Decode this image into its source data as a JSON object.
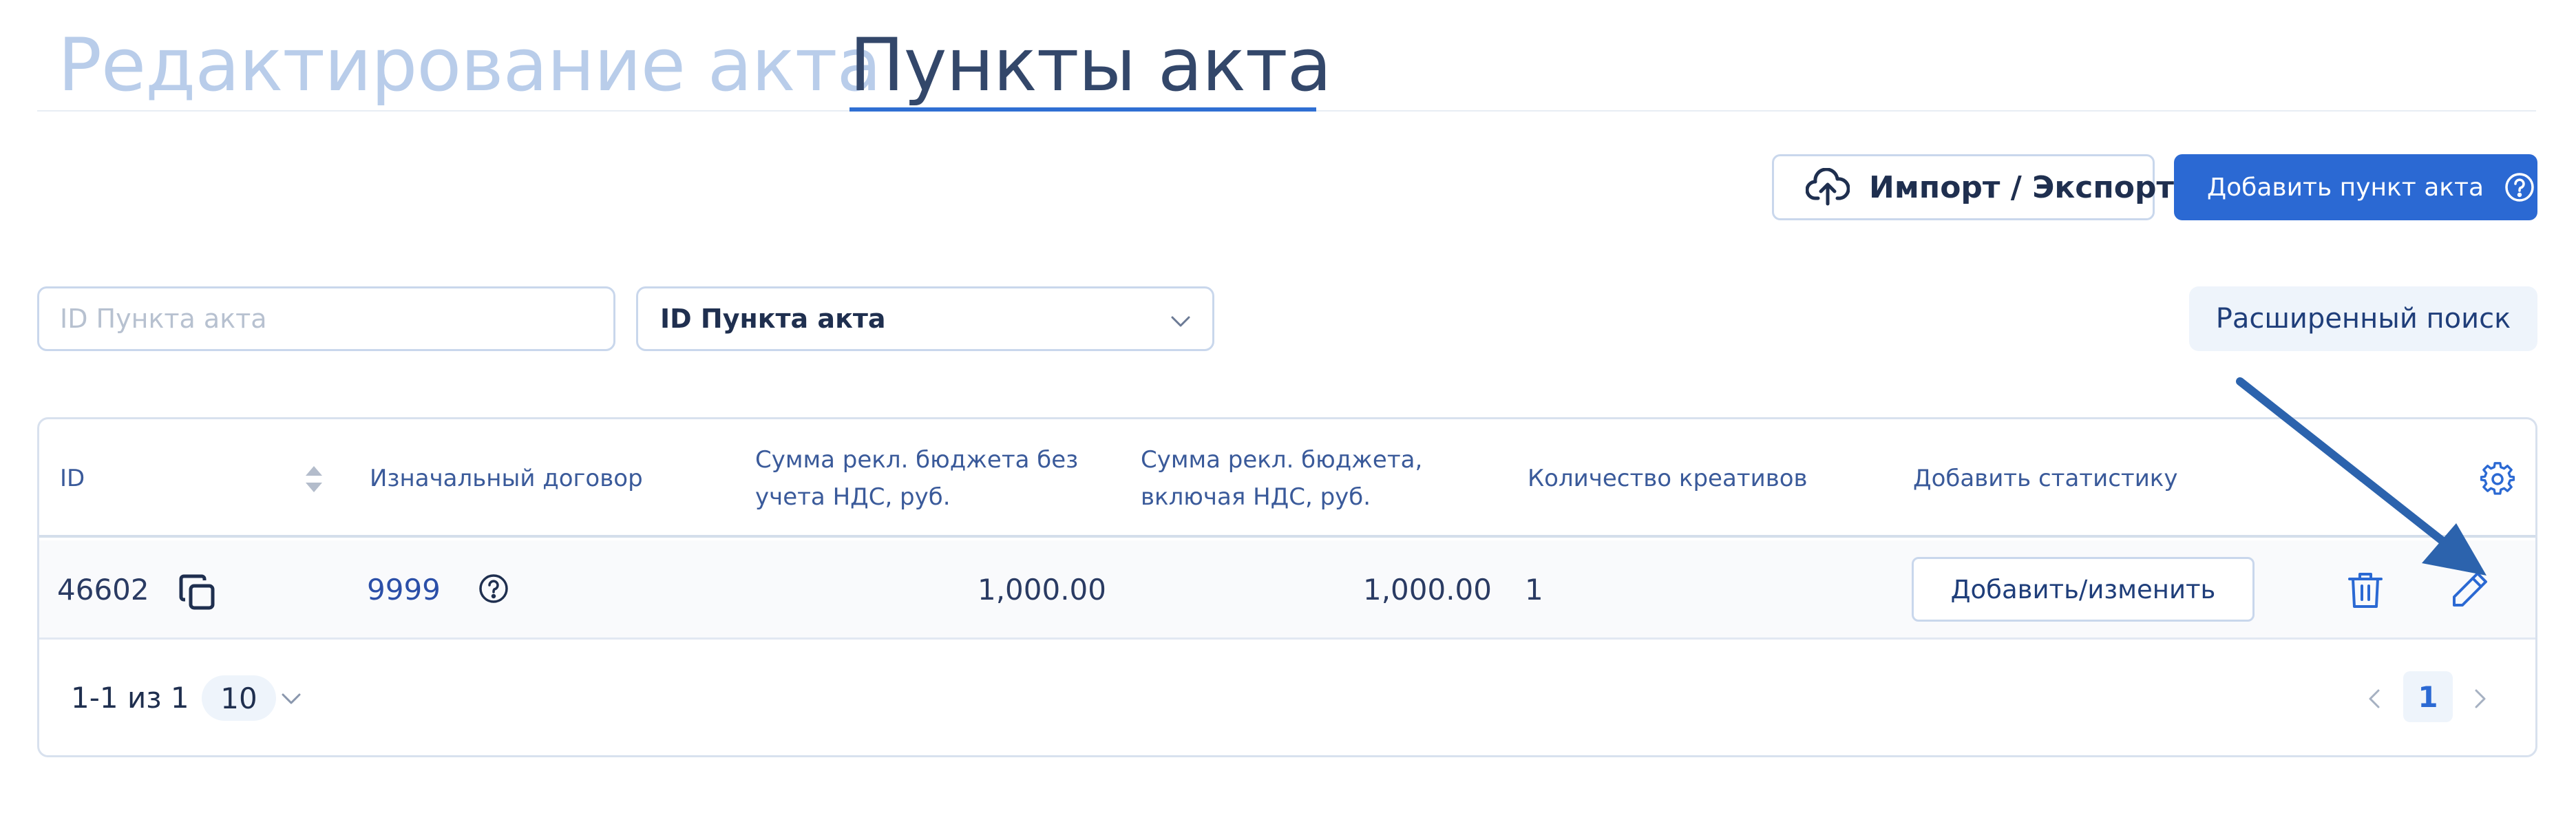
{
  "tabs": [
    {
      "label": "Редактирование акта",
      "active": false
    },
    {
      "label": "Пункты акта",
      "active": true
    }
  ],
  "toolbar": {
    "import_label": "Импорт / Экспорт",
    "add_label": "Добавить пункт акта"
  },
  "filters": {
    "search_placeholder": "ID Пункта акта",
    "search_value": "",
    "field_select_value": "ID Пункта акта",
    "advanced_label": "Расширенный поиск"
  },
  "table": {
    "headers": {
      "id": "ID",
      "contract": "Изначальный договор",
      "sum_no_vat_line1": "Сумма рекл. бюджета без",
      "sum_no_vat_line2": "учета НДС, руб.",
      "sum_vat_line1": "Сумма рекл. бюджета,",
      "sum_vat_line2": "включая НДС, руб.",
      "creatives": "Количество креативов",
      "stats": "Добавить статистику"
    },
    "rows": [
      {
        "id": "46602",
        "contract": "9999",
        "sum_no_vat": "1,000.00",
        "sum_vat": "1,000.00",
        "creatives": "1",
        "stats_button": "Добавить/изменить"
      }
    ]
  },
  "pagination": {
    "range": "1-1 из 1",
    "page_size": "10",
    "current_page": "1"
  },
  "icons": {
    "upload": "cloud-upload-icon",
    "help": "question-circle-icon",
    "chevron": "chevron-down-icon",
    "sort": "sort-icon",
    "settings": "gear-icon",
    "copy": "copy-icon",
    "delete": "trash-icon",
    "edit": "pencil-icon",
    "annotation": "arrow-annotation"
  },
  "colors": {
    "primary": "#2b69d3",
    "tab_inactive": "#b9cdea",
    "annotation_arrow": "#2c63ad"
  }
}
